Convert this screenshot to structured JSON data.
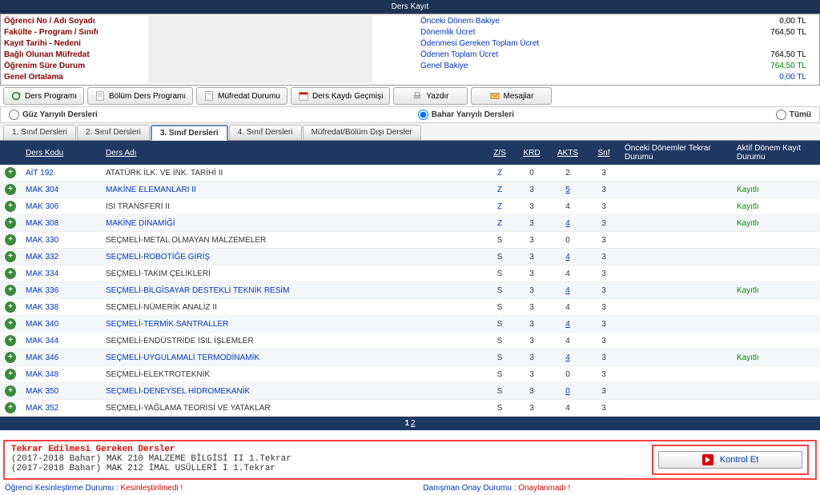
{
  "header": {
    "title": "Ders Kayıt"
  },
  "info_left": [
    "Öğrenci No / Adı Soyadı",
    "Fakülte - Program / Sınıfı",
    "Kayıt Tarihi - Nedeni",
    "Bağlı Olunan Müfredat",
    "Öğrenim Süre Durum",
    "Genel Ortalama"
  ],
  "balance": {
    "labels": {
      "onceki": "Önceki Dönem Bakiye",
      "donemlik": "Dönemlik Ücret",
      "blank": "",
      "toplam_odenecek": "Ödenmesi Gereken Toplam Ücret",
      "odenen": "Ödenen Toplam Ücret",
      "genel": "Genel Bakiye"
    },
    "values": {
      "onceki": "0,00 TL",
      "donemlik": "764,50 TL",
      "blank": "",
      "toplam_odenecek": "764,50 TL",
      "odenen": "764,50 TL",
      "genel": "0,00 TL"
    }
  },
  "toolbar": {
    "ders_programi": "Ders Programı",
    "bolum_ders_programi": "Bölüm Ders Programı",
    "mufredat_durumu": "Müfredat Durumu",
    "ders_kaydi_gecmisi": "Ders Kaydı Geçmişi",
    "yazdir": "Yazdır",
    "mesajlar": "Mesajlar"
  },
  "radios": {
    "guz": "Güz Yarıyılı Dersleri",
    "bahar": "Bahar Yarıyılı Dersleri",
    "tumu": "Tümü"
  },
  "tabs": [
    "1. Sınıf Dersleri",
    "2. Sınıf Dersleri",
    "3. Sınıf Dersleri",
    "4. Sınıf Dersleri",
    "Müfredat/Bölüm Dışı Dersler"
  ],
  "active_tab": "3. Sınıf Dersleri",
  "table": {
    "headers": {
      "add": "",
      "code": "Ders Kodu",
      "name": "Ders Adı",
      "zs": "Z/S",
      "krd": "KRD",
      "akts": "AKTS",
      "snf": "Snf",
      "tekrar": "Önceki Dönemler Tekrar Durumu",
      "kayit": "Aktif Dönem Kayıt Durumu"
    },
    "rows": [
      {
        "code": "AİT 192",
        "name": "ATATÜRK İLK. VE İNK. TARİHİ II",
        "name_link": false,
        "zs": "Z",
        "krd": "0",
        "akts": "2",
        "akts_link": false,
        "snf": "3",
        "tekrar": "",
        "kayit": ""
      },
      {
        "code": "MAK 304",
        "name": "MAKİNE ELEMANLARI II",
        "name_link": true,
        "zs": "Z",
        "krd": "3",
        "akts": "5",
        "akts_link": true,
        "snf": "3",
        "tekrar": "",
        "kayit": "Kayıtlı"
      },
      {
        "code": "MAK 306",
        "name": "ISI TRANSFERİ II",
        "name_link": false,
        "zs": "Z",
        "krd": "3",
        "akts": "4",
        "akts_link": false,
        "snf": "3",
        "tekrar": "",
        "kayit": "Kayıtlı"
      },
      {
        "code": "MAK 308",
        "name": "MAKİNE DİNAMİĞİ",
        "name_link": true,
        "zs": "Z",
        "krd": "3",
        "akts": "4",
        "akts_link": true,
        "snf": "3",
        "tekrar": "",
        "kayit": "Kayıtlı"
      },
      {
        "code": "MAK 330",
        "name": "SEÇMELİ-METAL OLMAYAN MALZEMELER",
        "name_link": false,
        "zs": "S",
        "krd": "3",
        "akts": "0",
        "akts_link": false,
        "snf": "3",
        "tekrar": "",
        "kayit": ""
      },
      {
        "code": "MAK 332",
        "name": "SEÇMELİ-ROBOTİĞE GİRİŞ",
        "name_link": true,
        "zs": "S",
        "krd": "3",
        "akts": "4",
        "akts_link": true,
        "snf": "3",
        "tekrar": "",
        "kayit": ""
      },
      {
        "code": "MAK 334",
        "name": "SEÇMELİ-TAKIM ÇELİKLERİ",
        "name_link": false,
        "zs": "S",
        "krd": "3",
        "akts": "4",
        "akts_link": false,
        "snf": "3",
        "tekrar": "",
        "kayit": ""
      },
      {
        "code": "MAK 336",
        "name": "SEÇMELİ-BİLGİSAYAR DESTEKLİ TEKNİK RESİM",
        "name_link": true,
        "zs": "S",
        "krd": "3",
        "akts": "4",
        "akts_link": true,
        "snf": "3",
        "tekrar": "",
        "kayit": "Kayıtlı"
      },
      {
        "code": "MAK 338",
        "name": "SEÇMELİ-NÜMERİK ANALİZ II",
        "name_link": false,
        "zs": "S",
        "krd": "3",
        "akts": "4",
        "akts_link": false,
        "snf": "3",
        "tekrar": "",
        "kayit": ""
      },
      {
        "code": "MAK 340",
        "name": "SEÇMELİ-TERMİK SANTRALLER",
        "name_link": true,
        "zs": "S",
        "krd": "3",
        "akts": "4",
        "akts_link": true,
        "snf": "3",
        "tekrar": "",
        "kayit": ""
      },
      {
        "code": "MAK 344",
        "name": "SEÇMELİ-ENDÜSTRİDE ISIL İŞLEMLER",
        "name_link": false,
        "zs": "S",
        "krd": "3",
        "akts": "4",
        "akts_link": false,
        "snf": "3",
        "tekrar": "",
        "kayit": ""
      },
      {
        "code": "MAK 346",
        "name": "SEÇMELİ-UYGULAMALI TERMODİNAMİK",
        "name_link": true,
        "zs": "S",
        "krd": "3",
        "akts": "4",
        "akts_link": true,
        "snf": "3",
        "tekrar": "",
        "kayit": "Kayıtlı"
      },
      {
        "code": "MAK 348",
        "name": "SEÇMELİ-ELEKTROTEKNİK",
        "name_link": false,
        "zs": "S",
        "krd": "3",
        "akts": "0",
        "akts_link": false,
        "snf": "3",
        "tekrar": "",
        "kayit": ""
      },
      {
        "code": "MAK 350",
        "name": "SEÇMELİ-DENEYSEL HİDROMEKANİK",
        "name_link": true,
        "zs": "S",
        "krd": "3",
        "akts": "0",
        "akts_link": true,
        "snf": "3",
        "tekrar": "",
        "kayit": ""
      },
      {
        "code": "MAK 352",
        "name": "SEÇMELİ-YAĞLAMA TEORİSİ VE YATAKLAR",
        "name_link": false,
        "zs": "S",
        "krd": "3",
        "akts": "4",
        "akts_link": false,
        "snf": "3",
        "tekrar": "",
        "kayit": ""
      }
    ]
  },
  "pager": {
    "current": "1",
    "next": "2"
  },
  "notice": {
    "header": "Tekrar Edilmesi Gereken Dersler",
    "lines": [
      "(2017-2018 Bahar) MAK 210 MALZEME BİLGİSİ II 1.Tekrar",
      "(2017-2018 Bahar) MAK 212 İMAL USÜLLERİ I 1.Tekrar"
    ]
  },
  "kontrol": {
    "label": "Kontrol Et"
  },
  "status": {
    "left_label": "Öğrenci Kesinleştirme Durumu : ",
    "left_val": "Kesinleştirilmedi !",
    "right_label": "Danışman Onay Durumu : ",
    "right_val": "Onaylanmadı !"
  }
}
